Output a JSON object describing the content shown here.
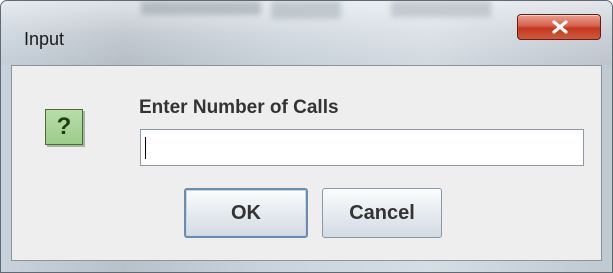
{
  "dialog": {
    "title": "Input",
    "close_glyph": "x",
    "prompt": "Enter Number of Calls",
    "input_value": "",
    "icon": "question-icon",
    "icon_glyph": "?",
    "ok_label": "OK",
    "cancel_label": "Cancel"
  },
  "colors": {
    "close_button": "#c2381f",
    "question_icon_bg": "#9ccc8a",
    "client_bg": "#eeeeee"
  }
}
